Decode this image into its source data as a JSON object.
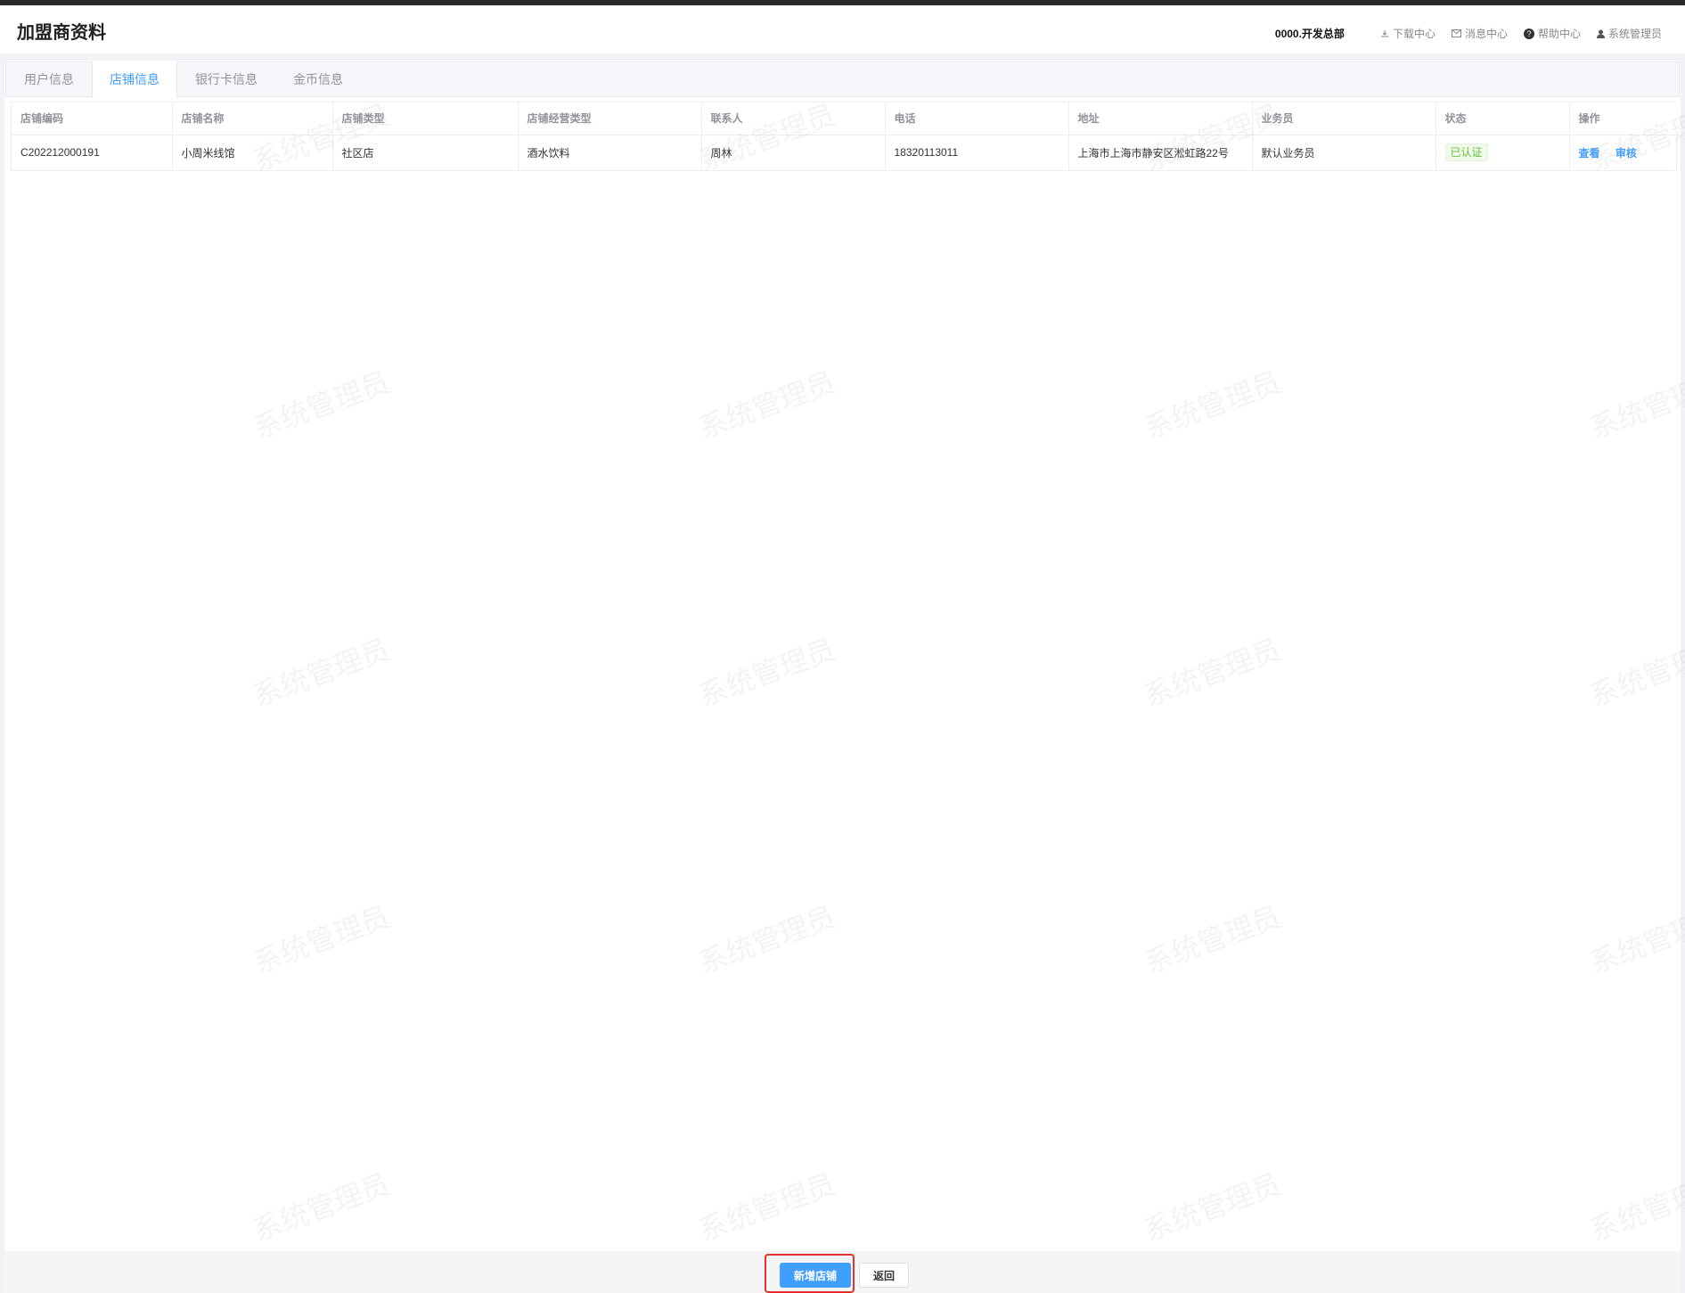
{
  "header": {
    "title": "加盟商资料",
    "org": "0000.开发总部",
    "links": [
      {
        "icon": "download-icon",
        "label": "下载中心"
      },
      {
        "icon": "mail-icon",
        "label": "消息中心"
      },
      {
        "icon": "help-icon",
        "label": "帮助中心"
      },
      {
        "icon": "user-icon",
        "label": "系统管理员"
      }
    ]
  },
  "tabs": [
    {
      "label": "用户信息",
      "active": false
    },
    {
      "label": "店铺信息",
      "active": true
    },
    {
      "label": "银行卡信息",
      "active": false
    },
    {
      "label": "金币信息",
      "active": false
    }
  ],
  "table": {
    "columns": [
      "店铺编码",
      "店铺名称",
      "店铺类型",
      "店铺经营类型",
      "联系人",
      "电话",
      "地址",
      "业务员",
      "状态",
      "操作"
    ],
    "rows": [
      {
        "code": "C202212000191",
        "name": "小周米线馆",
        "type": "社区店",
        "business_type": "酒水饮料",
        "contact": "周林",
        "phone": "18320113011",
        "address": "上海市上海市静安区淞虹路22号",
        "salesman": "默认业务员",
        "status": "已认证",
        "actions": [
          "查看",
          "审核"
        ]
      }
    ]
  },
  "watermark_text": "系统管理员",
  "footer": {
    "add_label": "新增店铺",
    "back_label": "返回"
  },
  "colors": {
    "primary": "#409eff",
    "success": "#67c23a",
    "highlight": "#e0332d"
  }
}
